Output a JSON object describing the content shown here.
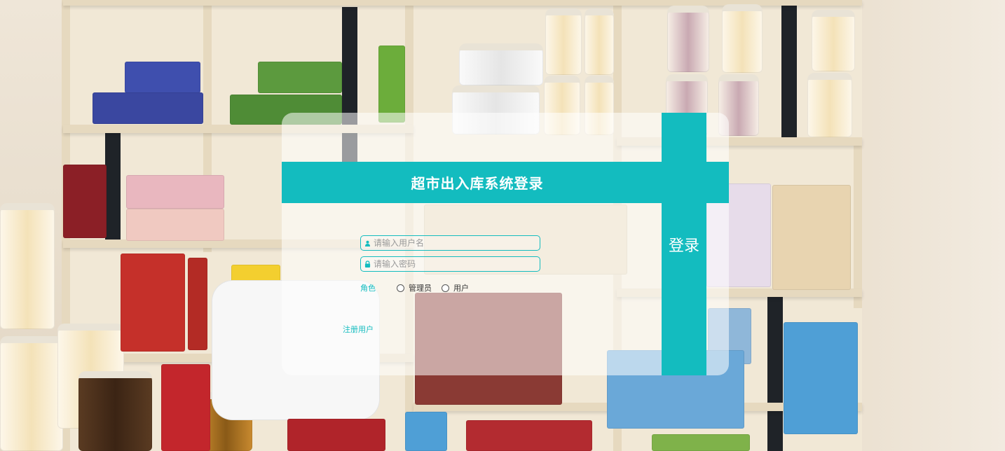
{
  "login": {
    "title": "超市出入库系统登录",
    "login_button": "登录",
    "username": {
      "placeholder": "请输入用户名",
      "icon": "user-icon",
      "value": ""
    },
    "password": {
      "placeholder": "请输入密码",
      "icon": "lock-icon",
      "value": ""
    },
    "role": {
      "label": "角色",
      "options": [
        "管理员",
        "用户"
      ],
      "selected": null
    },
    "register_link": "注册用户"
  },
  "colors": {
    "accent": "#13bcbf",
    "card_bg": "rgba(255,255,255,0.55)",
    "text_on_accent": "#ffffff"
  },
  "background": {
    "scene": "supermarket-shelves-photo"
  }
}
